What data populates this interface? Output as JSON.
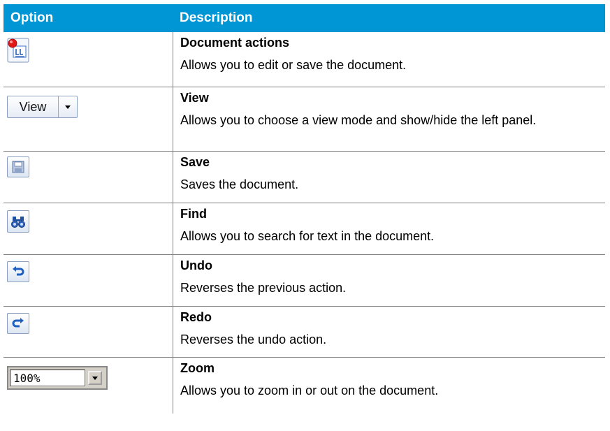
{
  "header": {
    "option": "Option",
    "description": "Description"
  },
  "colors": {
    "header_bg": "#0096d6",
    "header_text": "#ffffff",
    "grid": "#808080"
  },
  "rows": [
    {
      "icon": "document-actions-icon",
      "title": "Document actions",
      "text": "Allows you to edit or save the document."
    },
    {
      "icon": "view-dropdown",
      "button_label": "View",
      "title": "View",
      "text": "Allows you to choose a view mode and show/hide the left panel."
    },
    {
      "icon": "save-icon",
      "title": "Save",
      "text": "Saves the document."
    },
    {
      "icon": "binoculars-icon",
      "title": "Find",
      "text": "Allows you to search for text in the document."
    },
    {
      "icon": "undo-icon",
      "title": "Undo",
      "text": "Reverses the previous action."
    },
    {
      "icon": "redo-icon",
      "title": "Redo",
      "text": "Reverses the undo action."
    },
    {
      "icon": "zoom-combo",
      "zoom_value": "100%",
      "title": "Zoom",
      "text": "Allows you to zoom in or out on the document."
    }
  ]
}
